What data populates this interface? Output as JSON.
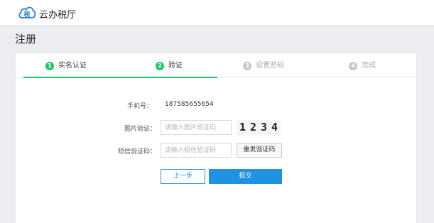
{
  "app": {
    "name": "云办税厅",
    "logo_glyph": "税"
  },
  "page": {
    "title": "注册"
  },
  "steps": [
    {
      "num": "1",
      "label": "实名认证",
      "state": "done"
    },
    {
      "num": "2",
      "label": "验证",
      "state": "current"
    },
    {
      "num": "3",
      "label": "设置密码",
      "state": "todo"
    },
    {
      "num": "4",
      "label": "完成",
      "state": "todo"
    }
  ],
  "form": {
    "phone_label": "手机号：",
    "phone_value": "187585655654",
    "image_code_label": "图片验证：",
    "image_code_placeholder": "请输入图片验证码",
    "captcha": [
      "1",
      "2",
      "3",
      "4"
    ],
    "sms_code_label": "短信验证码：",
    "sms_code_placeholder": "请输入短信验证码",
    "resend_label": "重发验证码"
  },
  "actions": {
    "prev_label": "上一步",
    "submit_label": "提交"
  },
  "colors": {
    "accent_green": "#20c46a",
    "primary_blue": "#2192e0",
    "inactive_gray": "#c6c6c6"
  }
}
